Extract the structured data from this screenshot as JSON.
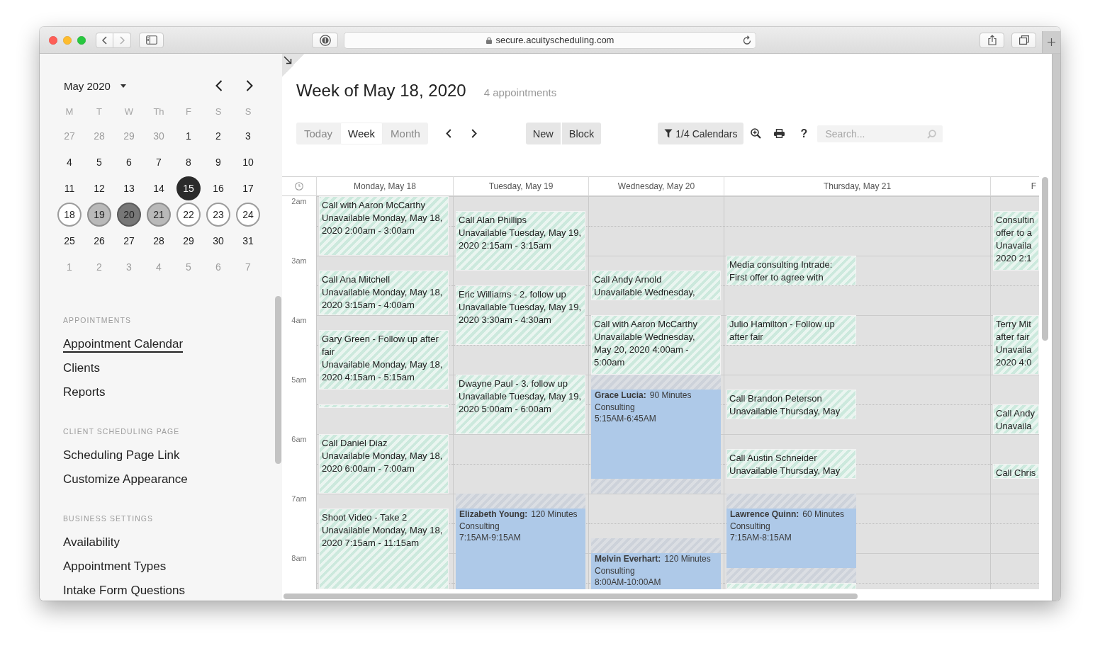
{
  "browser": {
    "url": "secure.acuityscheduling.com"
  },
  "sidebar": {
    "month": "May 2020",
    "weekdays": [
      "M",
      "T",
      "W",
      "Th",
      "F",
      "S",
      "S"
    ],
    "days": [
      {
        "label": "27",
        "muted": true,
        "selected": false,
        "today": false,
        "shaded": false,
        "dark": false
      },
      {
        "label": "28",
        "muted": true,
        "selected": false,
        "today": false,
        "shaded": false,
        "dark": false
      },
      {
        "label": "29",
        "muted": true,
        "selected": false,
        "today": false,
        "shaded": false,
        "dark": false
      },
      {
        "label": "30",
        "muted": true,
        "selected": false,
        "today": false,
        "shaded": false,
        "dark": false
      },
      {
        "label": "1",
        "muted": false,
        "selected": false,
        "today": false,
        "shaded": false,
        "dark": false
      },
      {
        "label": "2",
        "muted": false,
        "selected": false,
        "today": false,
        "shaded": false,
        "dark": false
      },
      {
        "label": "3",
        "muted": false,
        "selected": false,
        "today": false,
        "shaded": false,
        "dark": false
      },
      {
        "label": "4",
        "muted": false,
        "selected": false,
        "today": false,
        "shaded": false,
        "dark": false
      },
      {
        "label": "5",
        "muted": false,
        "selected": false,
        "today": false,
        "shaded": false,
        "dark": false
      },
      {
        "label": "6",
        "muted": false,
        "selected": false,
        "today": false,
        "shaded": false,
        "dark": false
      },
      {
        "label": "7",
        "muted": false,
        "selected": false,
        "today": false,
        "shaded": false,
        "dark": false
      },
      {
        "label": "8",
        "muted": false,
        "selected": false,
        "today": false,
        "shaded": false,
        "dark": false
      },
      {
        "label": "9",
        "muted": false,
        "selected": false,
        "today": false,
        "shaded": false,
        "dark": false
      },
      {
        "label": "10",
        "muted": false,
        "selected": false,
        "today": false,
        "shaded": false,
        "dark": false
      },
      {
        "label": "11",
        "muted": false,
        "selected": false,
        "today": false,
        "shaded": false,
        "dark": false
      },
      {
        "label": "12",
        "muted": false,
        "selected": false,
        "today": false,
        "shaded": false,
        "dark": false
      },
      {
        "label": "13",
        "muted": false,
        "selected": false,
        "today": false,
        "shaded": false,
        "dark": false
      },
      {
        "label": "14",
        "muted": false,
        "selected": false,
        "today": false,
        "shaded": false,
        "dark": false
      },
      {
        "label": "15",
        "muted": false,
        "selected": false,
        "today": true,
        "shaded": false,
        "dark": false
      },
      {
        "label": "16",
        "muted": false,
        "selected": false,
        "today": false,
        "shaded": false,
        "dark": false
      },
      {
        "label": "17",
        "muted": false,
        "selected": false,
        "today": false,
        "shaded": false,
        "dark": false
      },
      {
        "label": "18",
        "muted": false,
        "selected": true,
        "today": false,
        "shaded": false,
        "dark": false
      },
      {
        "label": "19",
        "muted": false,
        "selected": true,
        "today": false,
        "shaded": true,
        "dark": false
      },
      {
        "label": "20",
        "muted": false,
        "selected": true,
        "today": false,
        "shaded": true,
        "dark": true
      },
      {
        "label": "21",
        "muted": false,
        "selected": true,
        "today": false,
        "shaded": true,
        "dark": false
      },
      {
        "label": "22",
        "muted": false,
        "selected": true,
        "today": false,
        "shaded": false,
        "dark": false
      },
      {
        "label": "23",
        "muted": false,
        "selected": true,
        "today": false,
        "shaded": false,
        "dark": false
      },
      {
        "label": "24",
        "muted": false,
        "selected": true,
        "today": false,
        "shaded": false,
        "dark": false
      },
      {
        "label": "25",
        "muted": false,
        "selected": false,
        "today": false,
        "shaded": false,
        "dark": false
      },
      {
        "label": "26",
        "muted": false,
        "selected": false,
        "today": false,
        "shaded": false,
        "dark": false
      },
      {
        "label": "27",
        "muted": false,
        "selected": false,
        "today": false,
        "shaded": false,
        "dark": false
      },
      {
        "label": "28",
        "muted": false,
        "selected": false,
        "today": false,
        "shaded": false,
        "dark": false
      },
      {
        "label": "29",
        "muted": false,
        "selected": false,
        "today": false,
        "shaded": false,
        "dark": false
      },
      {
        "label": "30",
        "muted": false,
        "selected": false,
        "today": false,
        "shaded": false,
        "dark": false
      },
      {
        "label": "31",
        "muted": false,
        "selected": false,
        "today": false,
        "shaded": false,
        "dark": false
      },
      {
        "label": "1",
        "muted": true,
        "selected": false,
        "today": false,
        "shaded": false,
        "dark": false
      },
      {
        "label": "2",
        "muted": true,
        "selected": false,
        "today": false,
        "shaded": false,
        "dark": false
      },
      {
        "label": "3",
        "muted": true,
        "selected": false,
        "today": false,
        "shaded": false,
        "dark": false
      },
      {
        "label": "4",
        "muted": true,
        "selected": false,
        "today": false,
        "shaded": false,
        "dark": false
      },
      {
        "label": "5",
        "muted": true,
        "selected": false,
        "today": false,
        "shaded": false,
        "dark": false
      },
      {
        "label": "6",
        "muted": true,
        "selected": false,
        "today": false,
        "shaded": false,
        "dark": false
      },
      {
        "label": "7",
        "muted": true,
        "selected": false,
        "today": false,
        "shaded": false,
        "dark": false
      }
    ],
    "sections": [
      {
        "heading": "APPOINTMENTS",
        "items": [
          {
            "label": "Appointment Calendar",
            "selected": true
          },
          {
            "label": "Clients",
            "selected": false
          },
          {
            "label": "Reports",
            "selected": false
          }
        ]
      },
      {
        "heading": "CLIENT SCHEDULING PAGE",
        "items": [
          {
            "label": "Scheduling Page Link",
            "selected": false
          },
          {
            "label": "Customize Appearance",
            "selected": false
          }
        ]
      },
      {
        "heading": "BUSINESS SETTINGS",
        "items": [
          {
            "label": "Availability",
            "selected": false
          },
          {
            "label": "Appointment Types",
            "selected": false
          },
          {
            "label": "Intake Form Questions",
            "selected": false
          }
        ]
      }
    ]
  },
  "header": {
    "title": "Week of May 18, 2020",
    "count": "4 appointments"
  },
  "toolbar": {
    "views": [
      {
        "label": "Today",
        "selected": false
      },
      {
        "label": "Week",
        "selected": true
      },
      {
        "label": "Month",
        "selected": false
      }
    ],
    "actions": [
      "New",
      "Block"
    ],
    "filter": "1/4 Calendars",
    "help": "?",
    "search": {
      "placeholder": "Search..."
    }
  },
  "week": {
    "hours": [
      "2am",
      "3am",
      "4am",
      "5am",
      "6am",
      "7am",
      "8am"
    ],
    "days": [
      {
        "heading": "Monday, May 18",
        "slots": [
          {
            "kind": "blocked",
            "lines": [
              "Call with Aaron McCarthy",
              "Unavailable Monday, May 18,",
              "2020 2:00am - 3:00am"
            ]
          },
          {
            "kind": "blocked"
          },
          {
            "kind": "blocked"
          },
          {
            "kind": "blocked"
          },
          {
            "kind": "free"
          },
          {
            "kind": "blocked",
            "lines": [
              "Call Ana Mitchell",
              "Unavailable Monday, May 18,",
              "2020 3:15am - 4:00am"
            ]
          },
          {
            "kind": "blocked"
          },
          {
            "kind": "blocked"
          },
          {
            "kind": "free"
          },
          {
            "kind": "blocked",
            "lines": [
              "Gary Green - Follow up after",
              "fair",
              "Unavailable Monday, May 18,",
              "2020 4:15am - 5:15am"
            ]
          },
          {
            "kind": "blocked"
          },
          {
            "kind": "blocked"
          },
          {
            "kind": "blocked"
          },
          {
            "kind": "free"
          },
          {
            "kind": "strip"
          },
          {
            "kind": "free"
          },
          {
            "kind": "blocked",
            "lines": [
              "Call Daniel Diaz",
              "Unavailable Monday, May 18,",
              "2020 6:00am - 7:00am"
            ]
          },
          {
            "kind": "blocked"
          },
          {
            "kind": "blocked"
          },
          {
            "kind": "blocked"
          },
          {
            "kind": "free"
          },
          {
            "kind": "blocked",
            "lines": [
              "Shoot Video - Take 2",
              "Unavailable Monday, May 18,",
              "2020 7:15am - 11:15am"
            ]
          },
          {
            "kind": "blocked"
          },
          {
            "kind": "blocked"
          },
          {
            "kind": "blocked"
          },
          {
            "kind": "blocked"
          },
          {
            "kind": "blocked"
          }
        ]
      },
      {
        "heading": "Tuesday, May 19",
        "slots": [
          {
            "kind": "free"
          },
          {
            "kind": "blocked",
            "lines": [
              "Call Alan Phillips",
              "Unavailable Tuesday, May 19,",
              "2020 2:15am - 3:15am"
            ]
          },
          {
            "kind": "blocked"
          },
          {
            "kind": "blocked"
          },
          {
            "kind": "blocked"
          },
          {
            "kind": "free"
          },
          {
            "kind": "blocked",
            "lines": [
              "Eric Williams - 2. follow up",
              "Unavailable Tuesday, May 19,",
              "2020 3:30am - 4:30am"
            ]
          },
          {
            "kind": "blocked"
          },
          {
            "kind": "blocked"
          },
          {
            "kind": "blocked"
          },
          {
            "kind": "free"
          },
          {
            "kind": "free"
          },
          {
            "kind": "blocked",
            "lines": [
              "Dwayne Paul - 3. follow up",
              "Unavailable Tuesday, May 19,",
              "2020 5:00am - 6:00am"
            ]
          },
          {
            "kind": "blocked"
          },
          {
            "kind": "blocked"
          },
          {
            "kind": "blocked"
          },
          {
            "kind": "free"
          },
          {
            "kind": "free"
          },
          {
            "kind": "free"
          },
          {
            "kind": "free"
          },
          {
            "kind": "buffer"
          },
          {
            "kind": "appointment",
            "name": "Elizabeth Young:",
            "duration": "120 Minutes",
            "service": "Consulting",
            "time": "7:15AM-9:15AM"
          },
          {
            "kind": "appointment"
          },
          {
            "kind": "appointment"
          },
          {
            "kind": "appointment"
          },
          {
            "kind": "appointment"
          },
          {
            "kind": "appointment"
          }
        ]
      },
      {
        "heading": "Wednesday, May 20",
        "slots": [
          {
            "kind": "free"
          },
          {
            "kind": "free"
          },
          {
            "kind": "free"
          },
          {
            "kind": "free"
          },
          {
            "kind": "free"
          },
          {
            "kind": "blocked",
            "lines": [
              "Call Andy Arnold",
              "Unavailable Wednesday,"
            ]
          },
          {
            "kind": "blocked"
          },
          {
            "kind": "free"
          },
          {
            "kind": "blocked",
            "lines": [
              "Call with Aaron McCarthy",
              "Unavailable Wednesday,",
              "May 20, 2020 4:00am -",
              "5:00am"
            ]
          },
          {
            "kind": "blocked"
          },
          {
            "kind": "blocked"
          },
          {
            "kind": "blocked"
          },
          {
            "kind": "buffer"
          },
          {
            "kind": "appointment",
            "name": "Grace Lucia:",
            "duration": "90 Minutes",
            "service": "Consulting",
            "time": "5:15AM-6:45AM"
          },
          {
            "kind": "appointment"
          },
          {
            "kind": "appointment"
          },
          {
            "kind": "appointment"
          },
          {
            "kind": "appointment"
          },
          {
            "kind": "appointment"
          },
          {
            "kind": "buffer"
          },
          {
            "kind": "free"
          },
          {
            "kind": "free"
          },
          {
            "kind": "free"
          },
          {
            "kind": "buffer"
          },
          {
            "kind": "appointment",
            "name": "Melvin Everhart:",
            "duration": "120 Minutes",
            "service": "Consulting",
            "time": "8:00AM-10:00AM"
          },
          {
            "kind": "appointment"
          },
          {
            "kind": "appointment"
          }
        ]
      },
      {
        "heading": "Thursday, May 21",
        "slots": [
          {
            "kind": "free"
          },
          {
            "kind": "free"
          },
          {
            "kind": "free"
          },
          {
            "kind": "free"
          },
          {
            "kind": "blocked",
            "lines": [
              "Media consulting Intrade:",
              "First offer to agree with"
            ]
          },
          {
            "kind": "blocked"
          },
          {
            "kind": "free"
          },
          {
            "kind": "free"
          },
          {
            "kind": "blocked",
            "lines": [
              "Julio Hamilton - Follow up",
              "after fair"
            ]
          },
          {
            "kind": "blocked"
          },
          {
            "kind": "free"
          },
          {
            "kind": "free"
          },
          {
            "kind": "free"
          },
          {
            "kind": "blocked",
            "lines": [
              "Call Brandon Peterson",
              "Unavailable Thursday, May"
            ]
          },
          {
            "kind": "blocked"
          },
          {
            "kind": "free"
          },
          {
            "kind": "free"
          },
          {
            "kind": "blocked",
            "lines": [
              "Call Austin Schneider",
              "Unavailable Thursday, May"
            ]
          },
          {
            "kind": "blocked"
          },
          {
            "kind": "free"
          },
          {
            "kind": "buffer"
          },
          {
            "kind": "appointment",
            "name": "Lawrence Quinn:",
            "duration": "60 Minutes",
            "service": "Consulting",
            "time": "7:15AM-8:15AM"
          },
          {
            "kind": "appointment"
          },
          {
            "kind": "appointment"
          },
          {
            "kind": "appointment"
          },
          {
            "kind": "buffer"
          },
          {
            "kind": "blocked"
          }
        ]
      },
      {
        "heading": "F",
        "slots": [
          {
            "kind": "free"
          },
          {
            "kind": "blocked",
            "lines": [
              "Consultin",
              "offer to a",
              "Unavaila",
              "2020 2:1"
            ]
          },
          {
            "kind": "blocked"
          },
          {
            "kind": "blocked"
          },
          {
            "kind": "blocked"
          },
          {
            "kind": "free"
          },
          {
            "kind": "free"
          },
          {
            "kind": "free"
          },
          {
            "kind": "blocked",
            "lines": [
              "Terry Mit",
              "after fair",
              "Unavaila",
              "2020 4:0"
            ]
          },
          {
            "kind": "blocked"
          },
          {
            "kind": "blocked"
          },
          {
            "kind": "blocked"
          },
          {
            "kind": "free"
          },
          {
            "kind": "free"
          },
          {
            "kind": "blocked",
            "lines": [
              "Call Andy",
              "Unavaila"
            ]
          },
          {
            "kind": "blocked"
          },
          {
            "kind": "free"
          },
          {
            "kind": "free"
          },
          {
            "kind": "blocked",
            "lines": [
              "Call Chris"
            ]
          },
          {
            "kind": "free"
          },
          {
            "kind": "free"
          },
          {
            "kind": "free"
          },
          {
            "kind": "free"
          },
          {
            "kind": "free"
          },
          {
            "kind": "free"
          },
          {
            "kind": "free"
          },
          {
            "kind": "free"
          }
        ]
      }
    ]
  }
}
